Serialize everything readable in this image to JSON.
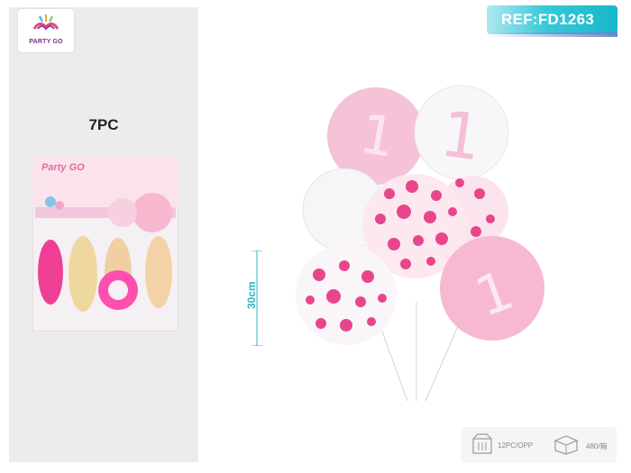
{
  "brand": {
    "logo_text": "PARTY GO"
  },
  "product": {
    "count_label": "7PC",
    "package_brand": "Party GO",
    "package_subtext": "7PC"
  },
  "ref": {
    "label": "REF:FD1263"
  },
  "dimension": {
    "height_label": "30cm"
  },
  "packing": {
    "inner_label": "12PC/OPP",
    "outer_label": "480/箱"
  },
  "icons": [
    "party-go-logo-icon",
    "package-box-icon",
    "carton-box-icon"
  ],
  "colors": {
    "accent": "#16b6c9",
    "balloon_pink": "#f6b7d1",
    "dot_pink": "#e8468c"
  }
}
